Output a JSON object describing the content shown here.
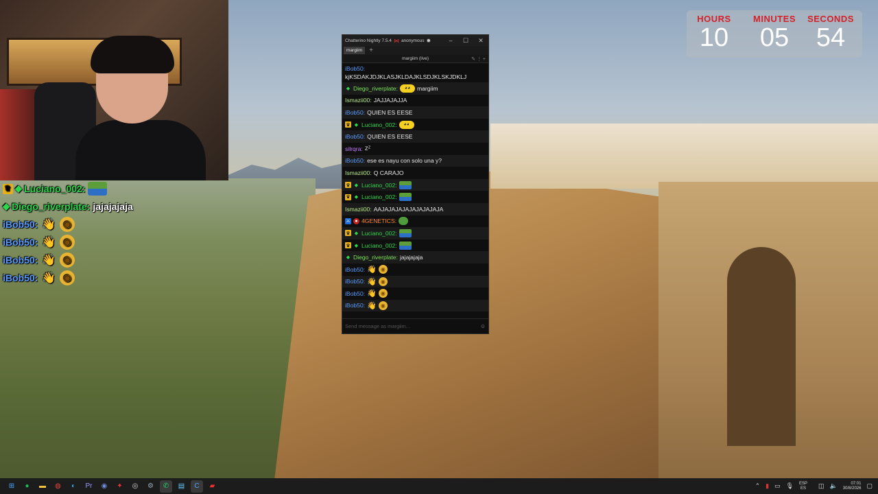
{
  "overlay_chat": [
    {
      "badges": [
        "crown-badge",
        "diamond-badge"
      ],
      "user": "Luciano_002:",
      "user_color": "#2bd94a",
      "text": "",
      "emotes": [
        "pepe-emote"
      ]
    },
    {
      "badges": [
        "diamond-badge"
      ],
      "user": "Diego_riverplate:",
      "user_color": "#2bd94a",
      "text": "jajajajaja",
      "emotes": []
    },
    {
      "badges": [],
      "user": "iBob50:",
      "user_color": "#5b9bff",
      "text": "",
      "emotes": [
        "wave-emote",
        "coin-emote"
      ]
    },
    {
      "badges": [],
      "user": "iBob50:",
      "user_color": "#5b9bff",
      "text": "",
      "emotes": [
        "wave-emote",
        "coin-emote"
      ]
    },
    {
      "badges": [],
      "user": "iBob50:",
      "user_color": "#5b9bff",
      "text": "",
      "emotes": [
        "wave-emote",
        "coin-emote"
      ]
    },
    {
      "badges": [],
      "user": "iBob50:",
      "user_color": "#5b9bff",
      "text": "",
      "emotes": [
        "wave-emote",
        "coin-emote"
      ]
    }
  ],
  "clock": {
    "hours_label": "HOURS",
    "minutes_label": "MINUTES",
    "seconds_label": "SECONDS",
    "hours": "10",
    "minutes": "05",
    "seconds": "54"
  },
  "chatterino": {
    "title": "Chatterino Nightly 7.5.4",
    "account": "anonymous",
    "tab_label": "margiim",
    "tab_add": "+",
    "split_title": "margiim (live)",
    "input_placeholder": "Send message as margiim...",
    "messages": [
      {
        "badges": [],
        "user": "iBob50:",
        "color": "#5b9bff",
        "text": "kjKSDAKJDJKLASJKLDAJKLSDJKLSKJDKLJ",
        "emotes": [],
        "wrap": true
      },
      {
        "badges": [
          "diamond"
        ],
        "user": "Diego_riverplate:",
        "color": "#7be354",
        "text": "margiim",
        "emotes": [
          "blob"
        ]
      },
      {
        "badges": [],
        "user": "Ismazii00:",
        "color": "#b8e986",
        "text": "JAJJAJAJJA",
        "emotes": []
      },
      {
        "badges": [],
        "user": "iBob50:",
        "color": "#5b9bff",
        "text": "QUIEN ES EESE",
        "emotes": []
      },
      {
        "badges": [
          "crown",
          "diamond"
        ],
        "user": "Luciano_002:",
        "color": "#2bd94a",
        "text": "",
        "emotes": [
          "blob"
        ]
      },
      {
        "badges": [],
        "user": "iBob50:",
        "color": "#5b9bff",
        "text": "QUIEN ES EESE",
        "emotes": []
      },
      {
        "badges": [],
        "user": "silrqra:",
        "color": "#c77dff",
        "text": "",
        "emotes": [
          "zz"
        ]
      },
      {
        "badges": [],
        "user": "iBob50:",
        "color": "#5b9bff",
        "text": "ese es nayu con solo una y?",
        "emotes": []
      },
      {
        "badges": [],
        "user": "Ismazii00:",
        "color": "#b8e986",
        "text": "Q CARAJO",
        "emotes": []
      },
      {
        "badges": [
          "crown",
          "diamond"
        ],
        "user": "Luciano_002:",
        "color": "#2bd94a",
        "text": "",
        "emotes": [
          "pepe"
        ]
      },
      {
        "badges": [
          "crown",
          "diamond"
        ],
        "user": "Luciano_002:",
        "color": "#2bd94a",
        "text": "",
        "emotes": [
          "pepe"
        ]
      },
      {
        "badges": [],
        "user": "Ismazii00:",
        "color": "#b8e986",
        "text": "AAJAJAJAJAJAJAJAJAJA",
        "emotes": []
      },
      {
        "badges": [
          "prime",
          "red"
        ],
        "user": "4GENETICS:",
        "color": "#ff8a1f",
        "text": "",
        "emotes": [
          "frog"
        ]
      },
      {
        "badges": [
          "crown",
          "diamond"
        ],
        "user": "Luciano_002:",
        "color": "#2bd94a",
        "text": "",
        "emotes": [
          "pepe"
        ]
      },
      {
        "badges": [
          "crown",
          "diamond"
        ],
        "user": "Luciano_002:",
        "color": "#2bd94a",
        "text": "",
        "emotes": [
          "pepe"
        ]
      },
      {
        "badges": [
          "diamond"
        ],
        "user": "Diego_riverplate:",
        "color": "#7be354",
        "text": "jajajajaja",
        "emotes": []
      },
      {
        "badges": [],
        "user": "iBob50:",
        "color": "#5b9bff",
        "text": "",
        "emotes": [
          "wave",
          "coin"
        ]
      },
      {
        "badges": [],
        "user": "iBob50:",
        "color": "#5b9bff",
        "text": "",
        "emotes": [
          "wave",
          "coin"
        ]
      },
      {
        "badges": [],
        "user": "iBob50:",
        "color": "#5b9bff",
        "text": "",
        "emotes": [
          "wave",
          "coin"
        ]
      },
      {
        "badges": [],
        "user": "iBob50:",
        "color": "#5b9bff",
        "text": "",
        "emotes": [
          "wave",
          "coin"
        ]
      }
    ]
  },
  "taskbar": {
    "apps": [
      "windows-start-icon",
      "spotify-icon",
      "file-explorer-icon",
      "chrome-icon",
      "edge-icon",
      "premiere-icon",
      "discord-icon",
      "game-icon",
      "obs-icon",
      "steam-icon",
      "whatsapp-icon",
      "notepad-icon",
      "chatterino-icon",
      "recording-icon"
    ],
    "lang_top": "ESP",
    "lang_bottom": "ES",
    "time": "07:01",
    "date": "30/8/2026"
  }
}
